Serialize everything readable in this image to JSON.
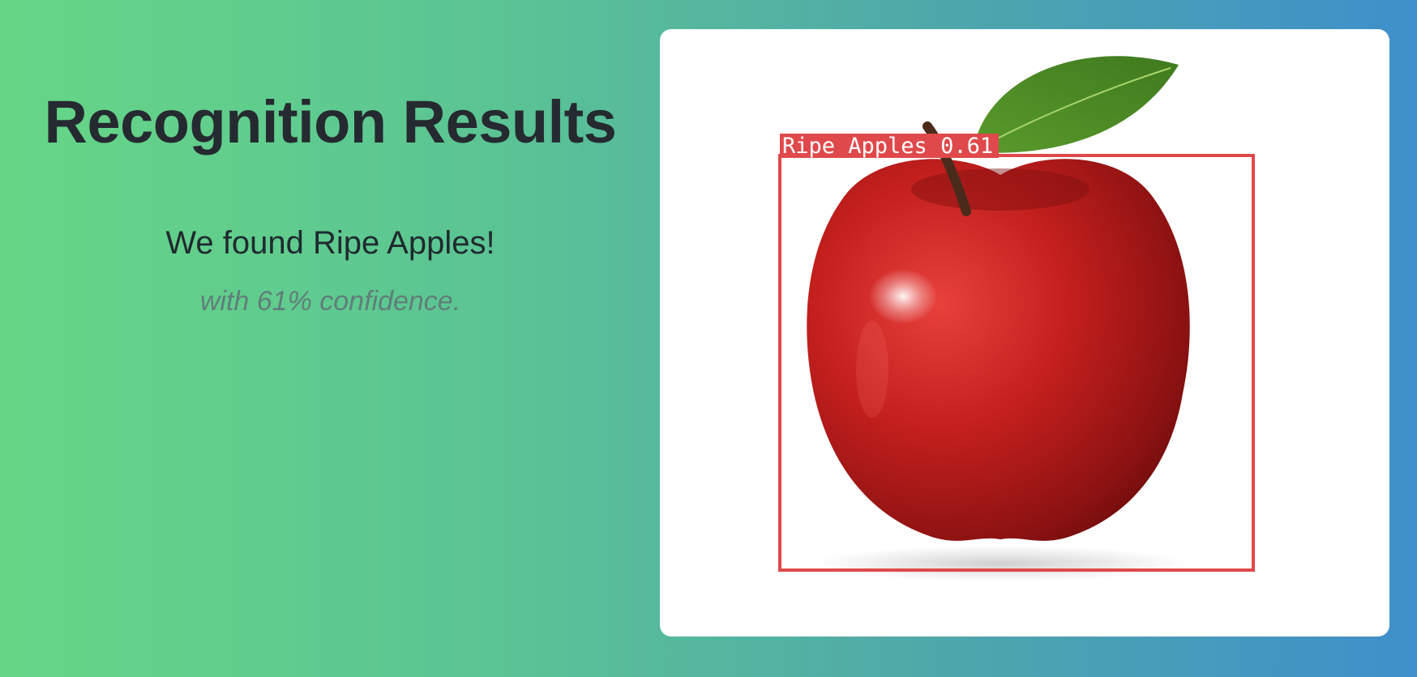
{
  "header": {
    "title": "Recognition Results"
  },
  "result": {
    "found_prefix": "We found ",
    "found_label": "Ripe Apples!",
    "confidence_text": "with 61% confidence."
  },
  "image": {
    "detection_label": "Ripe Apples 0.61",
    "box_color": "#e0494b"
  }
}
